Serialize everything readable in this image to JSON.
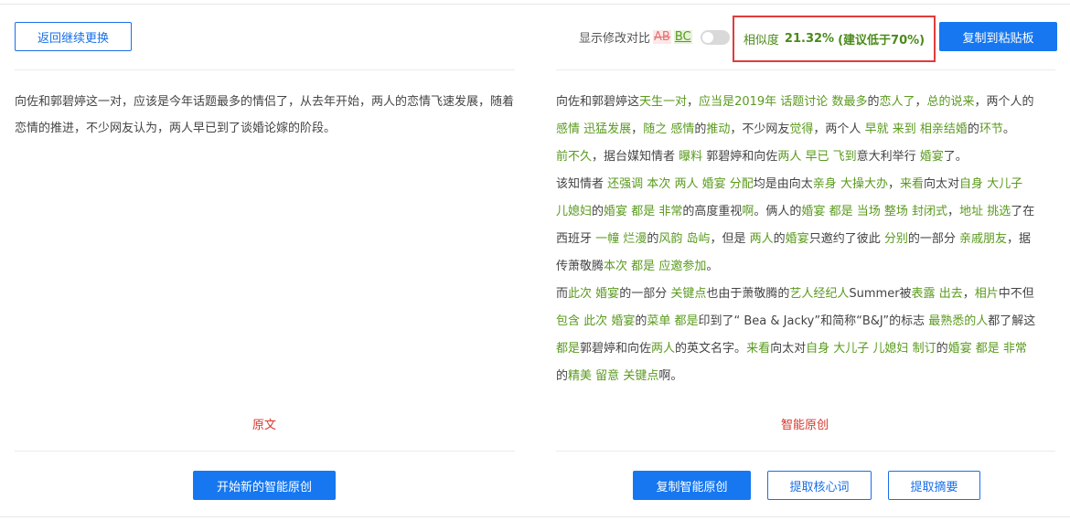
{
  "toolbar": {
    "back_label": "返回继续更换",
    "compare_label": "显示修改对比",
    "compare_ab": "AB",
    "compare_bc": "BC",
    "similarity_label": "相似度",
    "similarity_value": "21.32%",
    "similarity_hint": "(建议低于70%)",
    "copy_clipboard_label": "复制到粘贴板"
  },
  "left_panel": {
    "text": "向佐和郭碧婷这一对，应该是今年话题最多的情侣了，从去年开始，两人的恋情飞速发展，随着恋情的推进，不少网友认为，两人早已到了谈婚论嫁的阶段。",
    "caption": "原文",
    "start_button": "开始新的智能原创"
  },
  "right_panel": {
    "caption": "智能原创",
    "copy_button": "复制智能原创",
    "keywords_button": "提取核心词",
    "summary_button": "提取摘要",
    "colors": {
      "highlight": "#5a9a1e",
      "text": "#444444"
    }
  },
  "colors": {
    "primary": "#1677f0",
    "alert_border": "#e03c3c",
    "caption": "#d4382e"
  }
}
